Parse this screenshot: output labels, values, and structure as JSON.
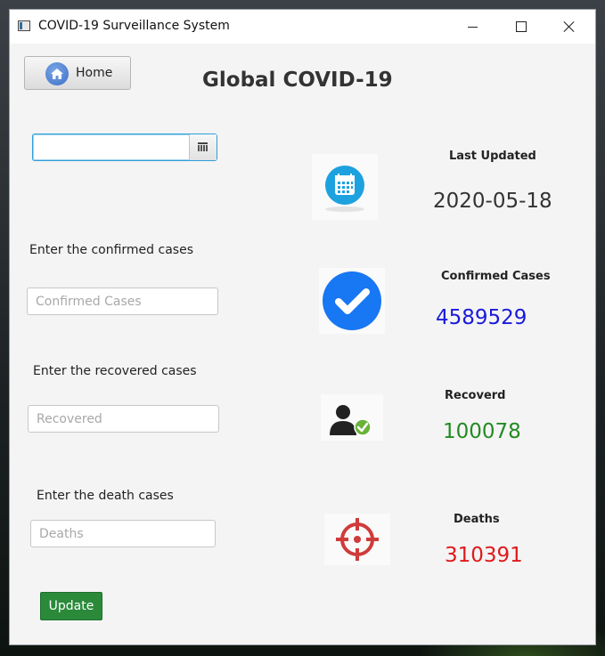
{
  "window": {
    "title": "COVID-19 Surveillance System"
  },
  "header": {
    "home_label": "Home",
    "title": "Global COVID-19"
  },
  "form": {
    "date_value": "",
    "confirmed_label": "Enter the confirmed cases",
    "confirmed_placeholder": "Confirmed Cases",
    "recovered_label": "Enter the recovered cases",
    "recovered_placeholder": "Recovered",
    "deaths_label": "Enter the death cases",
    "deaths_placeholder": "Deaths",
    "update_label": "Update"
  },
  "stats": {
    "last_updated": {
      "label": "Last Updated",
      "value": "2020-05-18",
      "color": "#333333",
      "icon": "calendar-icon"
    },
    "confirmed": {
      "label": "Confirmed Cases",
      "value": "4589529",
      "color": "#1a1adb",
      "icon": "check-circle-icon"
    },
    "recovered": {
      "label": "Recoverd",
      "value": "100078",
      "color": "#228b22",
      "icon": "person-check-icon"
    },
    "deaths": {
      "label": "Deaths",
      "value": "310391",
      "color": "#e0191b",
      "icon": "crosshair-icon"
    }
  }
}
